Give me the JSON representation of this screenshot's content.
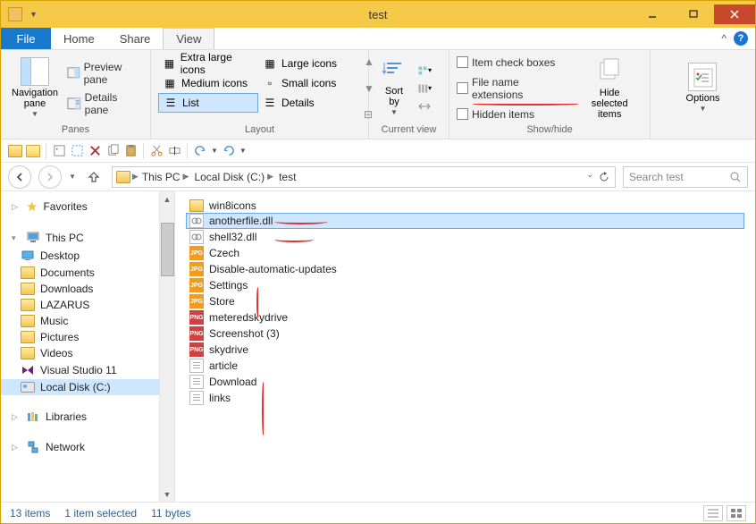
{
  "titlebar": {
    "title": "test"
  },
  "tabs": {
    "file": "File",
    "home": "Home",
    "share": "Share",
    "view": "View"
  },
  "ribbon": {
    "panes": {
      "nav_pane": "Navigation\npane",
      "preview": "Preview pane",
      "details": "Details pane",
      "group": "Panes"
    },
    "layout": {
      "xl": "Extra large icons",
      "lg": "Large icons",
      "md": "Medium icons",
      "sm": "Small icons",
      "list": "List",
      "det": "Details",
      "group": "Layout"
    },
    "cv": {
      "sort": "Sort\nby",
      "group": "Current view"
    },
    "sh": {
      "itemchk": "Item check boxes",
      "ext": "File name extensions",
      "hidden": "Hidden items",
      "hidesel": "Hide selected\nitems",
      "group": "Show/hide"
    },
    "opt": {
      "options": "Options"
    }
  },
  "breadcrumbs": [
    "This PC",
    "Local Disk (C:)",
    "test"
  ],
  "search": {
    "placeholder": "Search test"
  },
  "sidebar": {
    "favorites": "Favorites",
    "thispc": "This PC",
    "pc_children": [
      "Desktop",
      "Documents",
      "Downloads",
      "LAZARUS",
      "Music",
      "Pictures",
      "Videos",
      "Visual Studio 11",
      "Local Disk (C:)"
    ],
    "libraries": "Libraries",
    "network": "Network"
  },
  "files": [
    {
      "name": "win8icons",
      "type": "folder"
    },
    {
      "name": "anotherfile.dll",
      "type": "dll",
      "selected": true
    },
    {
      "name": "shell32.dll",
      "type": "dll"
    },
    {
      "name": "Czech",
      "type": "jpg"
    },
    {
      "name": "Disable-automatic-updates",
      "type": "jpg"
    },
    {
      "name": "Settings",
      "type": "jpg"
    },
    {
      "name": "Store",
      "type": "jpg"
    },
    {
      "name": "meteredskydrive",
      "type": "png"
    },
    {
      "name": "Screenshot (3)",
      "type": "png"
    },
    {
      "name": "skydrive",
      "type": "png"
    },
    {
      "name": "article",
      "type": "txt"
    },
    {
      "name": "Download",
      "type": "txt"
    },
    {
      "name": "links",
      "type": "txt"
    }
  ],
  "status": {
    "count": "13 items",
    "sel": "1 item selected",
    "size": "11 bytes"
  }
}
